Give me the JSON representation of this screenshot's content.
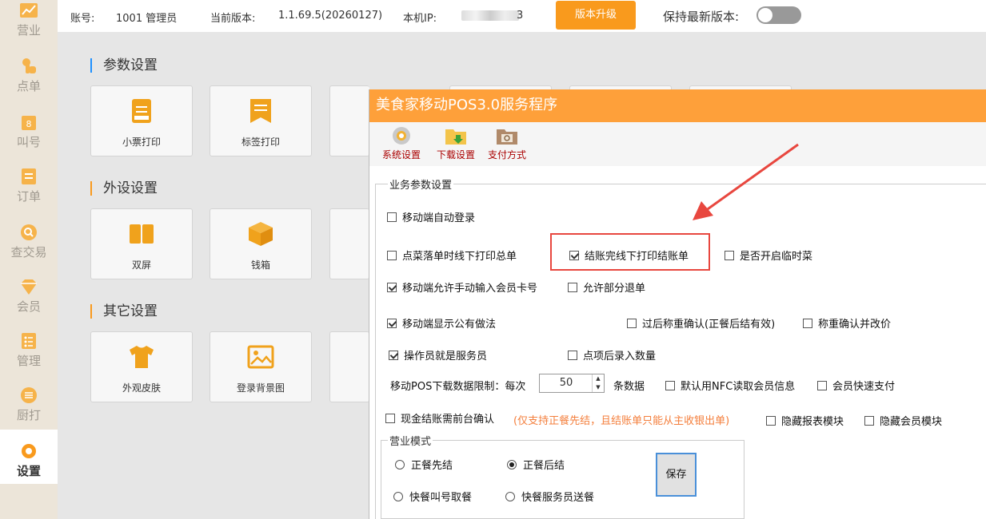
{
  "sidebar": {
    "items": [
      {
        "label": "营业",
        "icon": "chart-icon"
      },
      {
        "label": "点单",
        "icon": "hand-tap-icon"
      },
      {
        "label": "叫号",
        "icon": "number-call-icon"
      },
      {
        "label": "订单",
        "icon": "order-list-icon"
      },
      {
        "label": "查交易",
        "icon": "search-circle-icon"
      },
      {
        "label": "会员",
        "icon": "diamond-icon"
      },
      {
        "label": "管理",
        "icon": "manage-list-icon"
      },
      {
        "label": "厨打",
        "icon": "kitchen-print-icon"
      },
      {
        "label": "设置",
        "icon": "gear-icon"
      }
    ],
    "active_index": 8
  },
  "topbar": {
    "account_label": "账号:",
    "account_value": "1001 管理员",
    "version_label": "当前版本:",
    "version_value": "1.1.69.5(20260127)",
    "ip_label": "本机IP:",
    "ip_tail": "3",
    "upgrade_button": "版本升级",
    "keep_latest_label": "保持最新版本:",
    "keep_latest_on": false
  },
  "main": {
    "sections": [
      {
        "title": "参数设置",
        "cards": [
          "小票打印",
          "标签打印"
        ]
      },
      {
        "title": "外设设置",
        "cards": [
          "双屏",
          "钱箱"
        ]
      },
      {
        "title": "其它设置",
        "cards": [
          "外观皮肤",
          "登录背景图"
        ]
      }
    ]
  },
  "dialog": {
    "title": "美食家移动POS3.0服务程序",
    "toolbar": [
      {
        "label": "系统设置",
        "icon": "system-settings-icon"
      },
      {
        "label": "下载设置",
        "icon": "download-folder-icon"
      },
      {
        "label": "支付方式",
        "icon": "payment-folder-icon"
      }
    ],
    "group_title": "业务参数设置",
    "options": {
      "auto_login": {
        "label": "移动端自动登录",
        "checked": false
      },
      "print_total": {
        "label": "点菜落单时线下打印总单",
        "checked": false
      },
      "print_checkout": {
        "label": "结账完线下打印结账单",
        "checked": true
      },
      "temp_dish": {
        "label": "是否开启临时菜",
        "checked": false
      },
      "manual_member": {
        "label": "移动端允许手动输入会员卡号",
        "checked": true
      },
      "partial_refund": {
        "label": "允许部分退单",
        "checked": false
      },
      "public_method": {
        "label": "移动端显示公有做法",
        "checked": true
      },
      "weigh_confirm": {
        "label": "过后称重确认(正餐后结有效)",
        "checked": false
      },
      "weigh_price": {
        "label": "称重确认并改价",
        "checked": false
      },
      "operator_waiter": {
        "label": "操作员就是服务员",
        "checked": true
      },
      "qty_after_click": {
        "label": "点项后录入数量",
        "checked": false
      },
      "nfc_member": {
        "label": "默认用NFC读取会员信息",
        "checked": false
      },
      "member_quick_pay": {
        "label": "会员快速支付",
        "checked": false
      },
      "cash_confirm": {
        "label": "现金结账需前台确认",
        "checked": false
      },
      "hide_report": {
        "label": "隐藏报表模块",
        "checked": false
      },
      "hide_member": {
        "label": "隐藏会员模块",
        "checked": false
      }
    },
    "cash_note": "(仅支持正餐先结，且结账单只能从主收银出单)",
    "download_limit": {
      "prefix": "移动POS下载数据限制：每次",
      "value": "50",
      "suffix": "条数据"
    },
    "mode": {
      "title": "营业模式",
      "options": [
        "正餐先结",
        "正餐后结",
        "快餐叫号取餐",
        "快餐服务员送餐"
      ],
      "selected_index": 1
    },
    "save_button": "保存"
  },
  "colors": {
    "accent": "#f99a1d",
    "dialog_title": "#fea03a",
    "highlight": "#e8473f",
    "note": "#f47e3b"
  }
}
